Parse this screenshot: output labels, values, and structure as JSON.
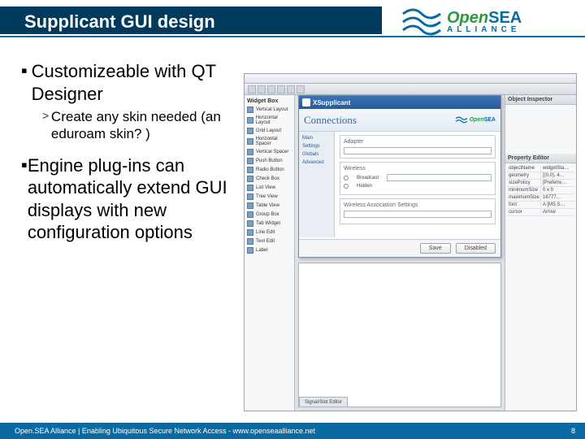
{
  "slide": {
    "title": "Supplicant GUI design",
    "bullets": [
      {
        "text": "Customizeable with QT Designer",
        "sub": [
          {
            "text": "Create any skin needed (an eduroam skin? )"
          }
        ]
      },
      {
        "text": "Engine plug-ins can automatically extend GUI displays with new configuration options",
        "sub": []
      }
    ]
  },
  "logo": {
    "open": "Open",
    "sea": "SEA",
    "alliance": "ALLIANCE"
  },
  "screenshot": {
    "widgetbox_header": "Widget Box",
    "widgets": [
      "Vertical Layout",
      "Horizontal Layout",
      "Grid Layout",
      "Horizontal Spacer",
      "Vertical Spacer",
      "Push Button",
      "Radio Button",
      "Check Box",
      "List View",
      "Tree View",
      "Table View",
      "Group Box",
      "Tab Widget",
      "Line Edit",
      "Text Edit",
      "Label"
    ],
    "object_inspector": "Object Inspector",
    "property_editor": "Property Editor",
    "props": [
      [
        "objectName",
        "widgetSta…"
      ],
      [
        "geometry",
        "[(0,0), 4…"
      ],
      [
        "sizePolicy",
        "[Preferre…"
      ],
      [
        "minimumSize",
        "0 x 0"
      ],
      [
        "maximumSize",
        "16777…"
      ],
      [
        "font",
        "A [MS S…"
      ],
      [
        "cursor",
        "Arrow"
      ]
    ],
    "dialog": {
      "title": "XSupplicant",
      "header": "Connections",
      "nav": [
        "Main",
        "Settings",
        "Globals",
        "Advanced"
      ],
      "adapter_label": "Adapter",
      "wireless_label": "Wireless",
      "radio_broadcast": "Broadcast",
      "radio_hidden": "Hidden",
      "assoc_label": "Wireless Association Settings",
      "btn_save": "Save",
      "btn_disabled": "Disabled"
    },
    "signal_tab": "Signal/Slot Editor"
  },
  "footer": {
    "left": "Open.SEA Alliance | Enabling Ubiquitous Secure Network Access - www.openseaalliance.net",
    "right": "8"
  }
}
